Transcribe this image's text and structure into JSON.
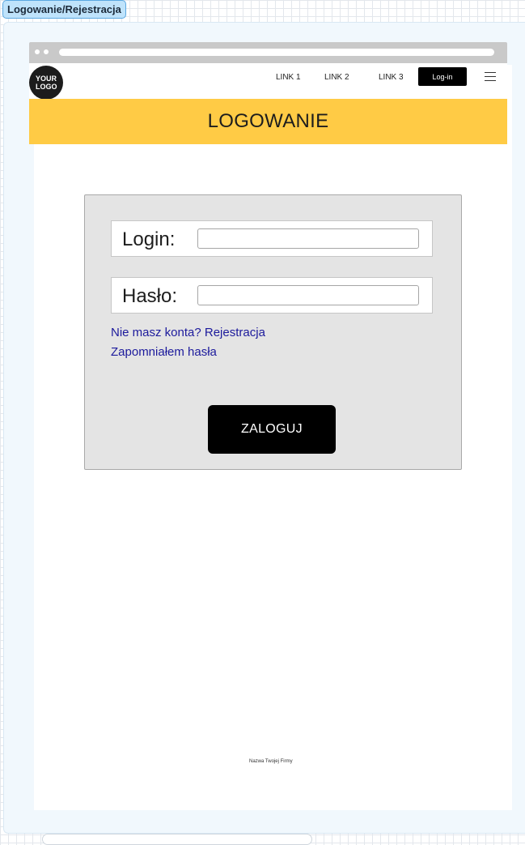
{
  "frame": {
    "label": "Logowanie/Rejestracja"
  },
  "header": {
    "logo_line1": "YOUR",
    "logo_line2": "LOGO",
    "links": [
      "LINK 1",
      "LINK 2",
      "LINK 3"
    ],
    "login_button": "Log-in"
  },
  "banner": {
    "title": "LOGOWANIE"
  },
  "form": {
    "login_label": "Login:",
    "login_value": "",
    "password_label": "Hasło:",
    "password_value": "",
    "register_link": "Nie masz konta? Rejestracja",
    "forgot_link": "Zapomniałem hasła",
    "submit_label": "ZALOGUJ"
  },
  "footer": {
    "company": "Nazwa Twojej Firmy"
  },
  "colors": {
    "banner": "#ffcb45",
    "link": "#1c1a9c",
    "panel": "#e4e4e4",
    "button": "#000000"
  }
}
